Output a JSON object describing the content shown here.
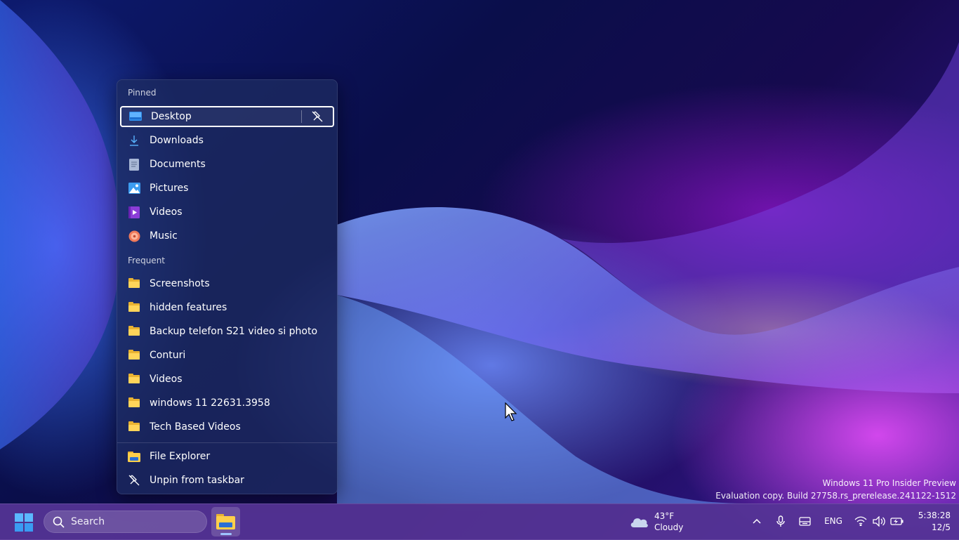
{
  "jumplist": {
    "pinned_header": "Pinned",
    "pinned": [
      {
        "label": "Desktop",
        "icon": "desktop-icon"
      },
      {
        "label": "Downloads",
        "icon": "download-icon"
      },
      {
        "label": "Documents",
        "icon": "document-icon"
      },
      {
        "label": "Pictures",
        "icon": "pictures-icon"
      },
      {
        "label": "Videos",
        "icon": "videos-icon"
      },
      {
        "label": "Music",
        "icon": "music-icon"
      }
    ],
    "frequent_header": "Frequent",
    "frequent": [
      {
        "label": "Screenshots",
        "icon": "folder-icon"
      },
      {
        "label": "hidden features",
        "icon": "folder-icon"
      },
      {
        "label": "Backup telefon S21 video si photo",
        "icon": "folder-icon"
      },
      {
        "label": "Conturi",
        "icon": "folder-icon"
      },
      {
        "label": "Videos",
        "icon": "folder-icon"
      },
      {
        "label": "windows 11 22631.3958",
        "icon": "folder-icon"
      },
      {
        "label": "Tech Based Videos",
        "icon": "folder-icon"
      }
    ],
    "actions": [
      {
        "label": "File Explorer",
        "icon": "file-explorer-icon"
      },
      {
        "label": "Unpin from taskbar",
        "icon": "unpin-icon"
      }
    ]
  },
  "watermark": {
    "line1": "Windows 11 Pro Insider Preview",
    "line2": "Evaluation copy. Build 27758.rs_prerelease.241122-1512"
  },
  "taskbar": {
    "search_label": "Search",
    "weather": {
      "temp": "43°F",
      "condition": "Cloudy"
    },
    "language": "ENG",
    "time": "5:38:28",
    "date": "12/5"
  },
  "colors": {
    "taskbar": "#563496",
    "jumplist_bg": "#1c2a60",
    "folder": "#ffd45a",
    "accent": "#9ec4ff"
  }
}
